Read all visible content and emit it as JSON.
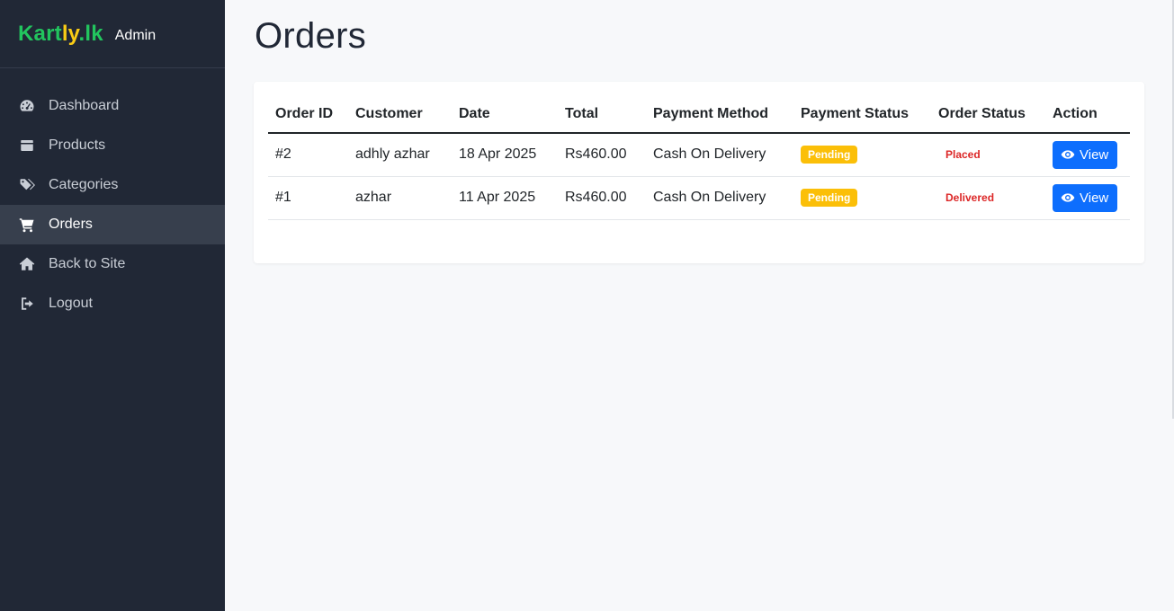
{
  "brand": {
    "logo_part1": "Kart",
    "logo_part2": "ly",
    "logo_part3": ".lk",
    "subtitle": "Admin"
  },
  "sidebar": {
    "items": [
      {
        "label": "Dashboard",
        "icon": "gauge-icon"
      },
      {
        "label": "Products",
        "icon": "box-icon"
      },
      {
        "label": "Categories",
        "icon": "tags-icon"
      },
      {
        "label": "Orders",
        "icon": "cart-icon",
        "active": true
      },
      {
        "label": "Back to Site",
        "icon": "home-icon"
      },
      {
        "label": "Logout",
        "icon": "logout-icon"
      }
    ]
  },
  "page": {
    "title": "Orders"
  },
  "table": {
    "headers": [
      "Order ID",
      "Customer",
      "Date",
      "Total",
      "Payment Method",
      "Payment Status",
      "Order Status",
      "Action"
    ],
    "rows": [
      {
        "id": "#2",
        "customer": "adhly azhar",
        "date": "18 Apr 2025",
        "total": "Rs460.00",
        "method": "Cash On Delivery",
        "payment_status": "Pending",
        "order_status": "Placed",
        "action": "View"
      },
      {
        "id": "#1",
        "customer": "azhar",
        "date": "11 Apr 2025",
        "total": "Rs460.00",
        "method": "Cash On Delivery",
        "payment_status": "Pending",
        "order_status": "Delivered",
        "action": "View"
      }
    ]
  },
  "colors": {
    "sidebar_bg": "#212836",
    "accent_green": "#22c55e",
    "accent_yellow": "#facc15",
    "pending_badge": "#fbbf08",
    "status_red": "#dc2626",
    "primary_button": "#0d6efd"
  }
}
